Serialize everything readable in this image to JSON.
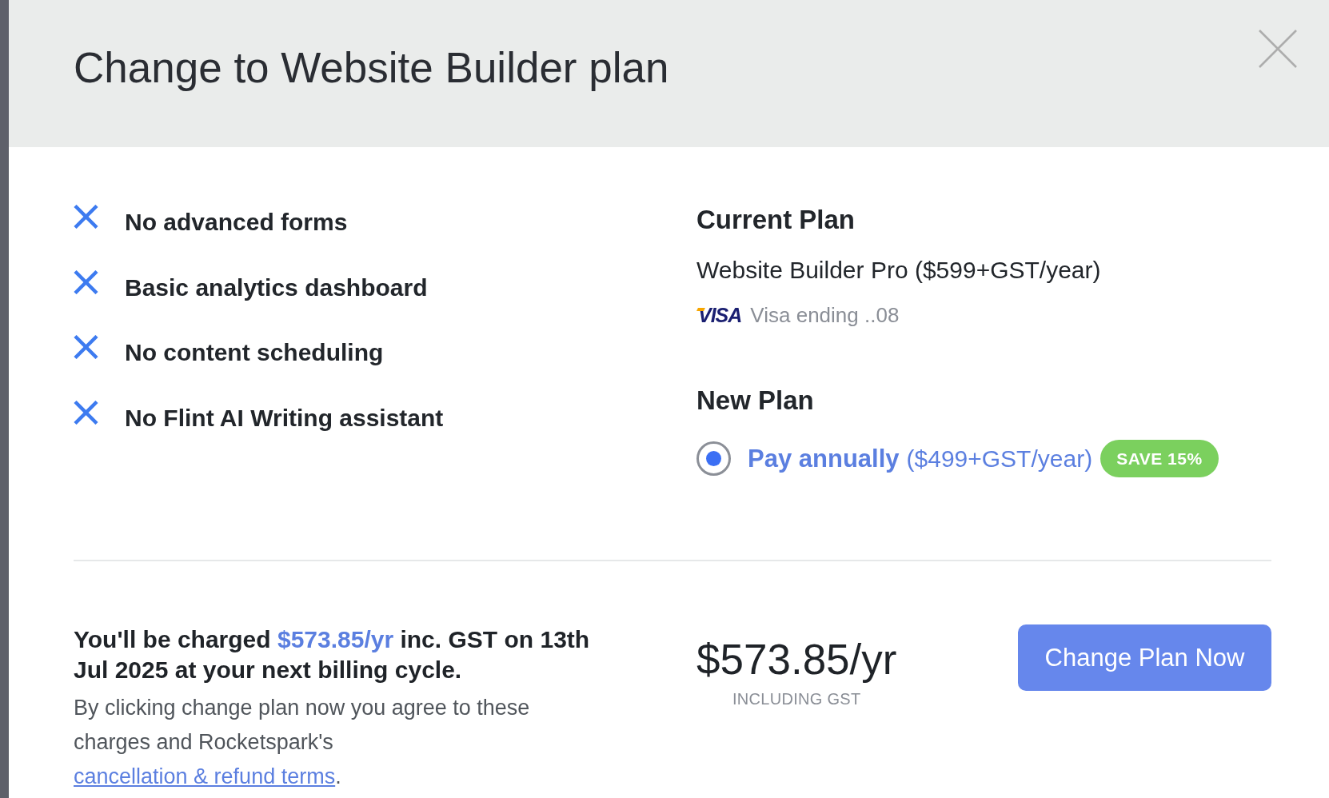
{
  "dialog": {
    "title": "Change to Website Builder plan"
  },
  "features": [
    {
      "label": "No advanced forms",
      "included": false
    },
    {
      "label": "Basic analytics dashboard",
      "included": false
    },
    {
      "label": "No content scheduling",
      "included": false
    },
    {
      "label": "No Flint AI Writing assistant",
      "included": false
    }
  ],
  "current_plan": {
    "heading": "Current Plan",
    "plan": "Website Builder Pro ($599+GST/year)",
    "card_brand": "VISA",
    "card": "Visa ending ..08"
  },
  "new_plan": {
    "heading": "New Plan",
    "options": [
      {
        "label": "Pay annually",
        "price": "($499+GST/year)",
        "badge": "SAVE 15%",
        "selected": true
      }
    ]
  },
  "summary": {
    "charge_before": "You'll be charged",
    "charge_amount": "$573.85/yr",
    "charge_after": "inc. GST on 13th Jul 2025 at your next billing cycle.",
    "agreement": "By clicking change plan now you agree to these charges and Rocketspark's",
    "terms_link": "cancellation & refund terms",
    "agreement_end": ".",
    "price": "$573.85/yr",
    "price_note": "INCLUDING GST",
    "button": "Change Plan Now"
  }
}
